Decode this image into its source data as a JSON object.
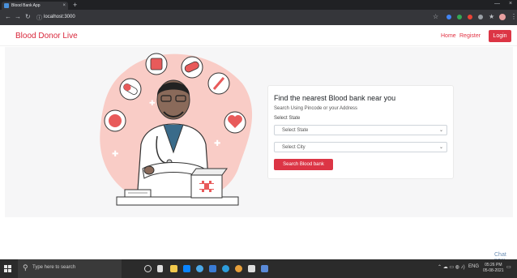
{
  "browser": {
    "tab_title": "Blood Bank App",
    "tab_close": "×",
    "new_tab": "+",
    "url": "localhost:3000",
    "minimize": "—",
    "close": "×"
  },
  "navbar": {
    "brand": "Blood Donor Live",
    "links": [
      "Home",
      "Register"
    ],
    "login_label": "Login"
  },
  "search_card": {
    "title": "Find the nearest Blood bank near you",
    "subtitle": "Search Using Pincode or your Address",
    "state_label": "Select State",
    "state_select": "Select State",
    "city_select": "Select City",
    "button_label": "Search Blood bank"
  },
  "chat": {
    "label": "Chat now"
  },
  "taskbar": {
    "search_placeholder": "Type here to search",
    "time": "05:26 PM",
    "date": "05-08-2021",
    "lang": "ENG"
  },
  "colors": {
    "brand_red": "#dc3545",
    "hero_bg": "#f6f6f7",
    "blob": "#f9ccc6"
  }
}
